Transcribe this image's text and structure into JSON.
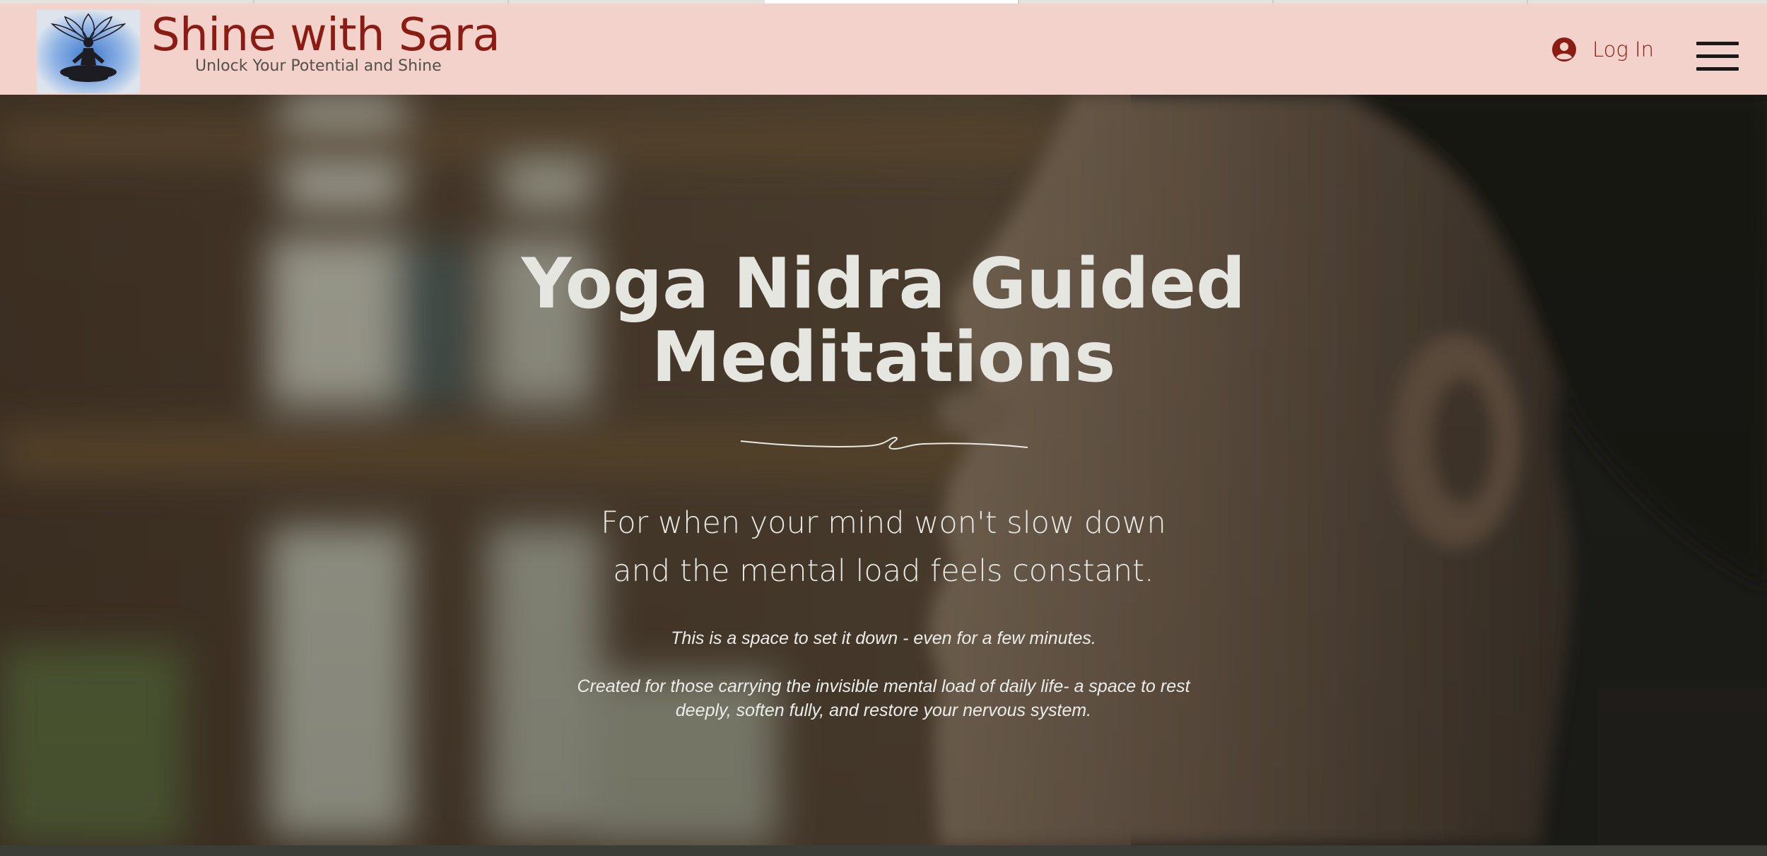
{
  "site": {
    "title": "Shine with Sara",
    "tagline": "Unlock Your Potential and Shine"
  },
  "header": {
    "login_label": "Log In",
    "logo_icon": "meditation-lotus-logo",
    "login_icon": "user-circle-icon",
    "menu_icon": "hamburger-menu-icon"
  },
  "hero": {
    "title": "Yoga Nidra Guided Meditations",
    "subtitle_line1": "For when your mind won't slow down",
    "subtitle_line2": "and the mental load feels constant.",
    "intro": "This is a space to set it down - even for a few minutes.",
    "description": "Created for those carrying the invisible mental load of daily life- a space to rest deeply, soften fully, and restore your nervous system."
  },
  "colors": {
    "header_bg": "#f2d2ca",
    "brand": "#8a1c14",
    "hero_text": "#e6e6e0"
  }
}
